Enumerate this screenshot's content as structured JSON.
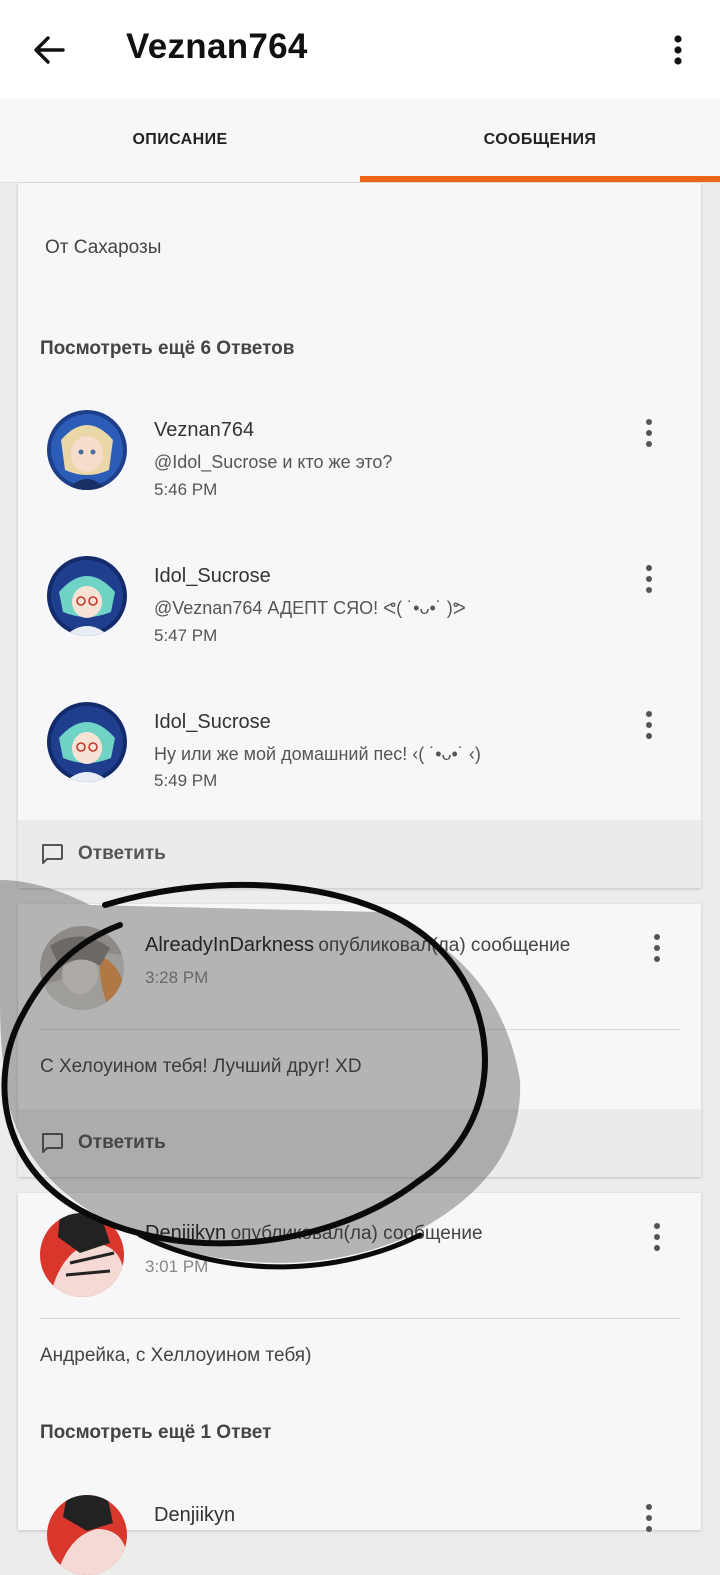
{
  "header": {
    "title": "Veznan764"
  },
  "tabs": [
    {
      "label": "ОПИСАНИЕ"
    },
    {
      "label": "СООБЩЕНИЯ"
    }
  ],
  "accent_color": "#f06418",
  "thread1": {
    "post_text": "От Сахарозы",
    "more_replies": "Посмотреть ещё 6 Ответов",
    "replies": [
      {
        "user": "Veznan764",
        "text": "@Idol_Sucrose  и кто же это?",
        "time": "5:46 PM"
      },
      {
        "user": "Idol_Sucrose",
        "text": "@Veznan764  АДЕПТ СЯО! ᕙ( ˙•ᴗ•˙ )ᕗ",
        "time": "5:47 PM"
      },
      {
        "user": "Idol_Sucrose",
        "text": "Ну или же мой домашний пес! ‹( ˙•ᴗ•˙ ‹)",
        "time": "5:49 PM"
      }
    ],
    "reply_label": "Ответить"
  },
  "post2": {
    "user": "AlreadyInDarkness",
    "action": "опубликовал(ла) сообщение",
    "time": "3:28 PM",
    "text": "С Хелоуином тебя! Лучший друг! XD",
    "reply_label": "Ответить"
  },
  "post3": {
    "user": "Denjiikyn",
    "action": "опубликовал(ла) сообщение",
    "time": "3:01 PM",
    "text": "Андрейка, с Хеллоуином тебя)",
    "more_replies": "Посмотреть ещё 1 Ответ",
    "reply_user": "Denjiikyn"
  }
}
